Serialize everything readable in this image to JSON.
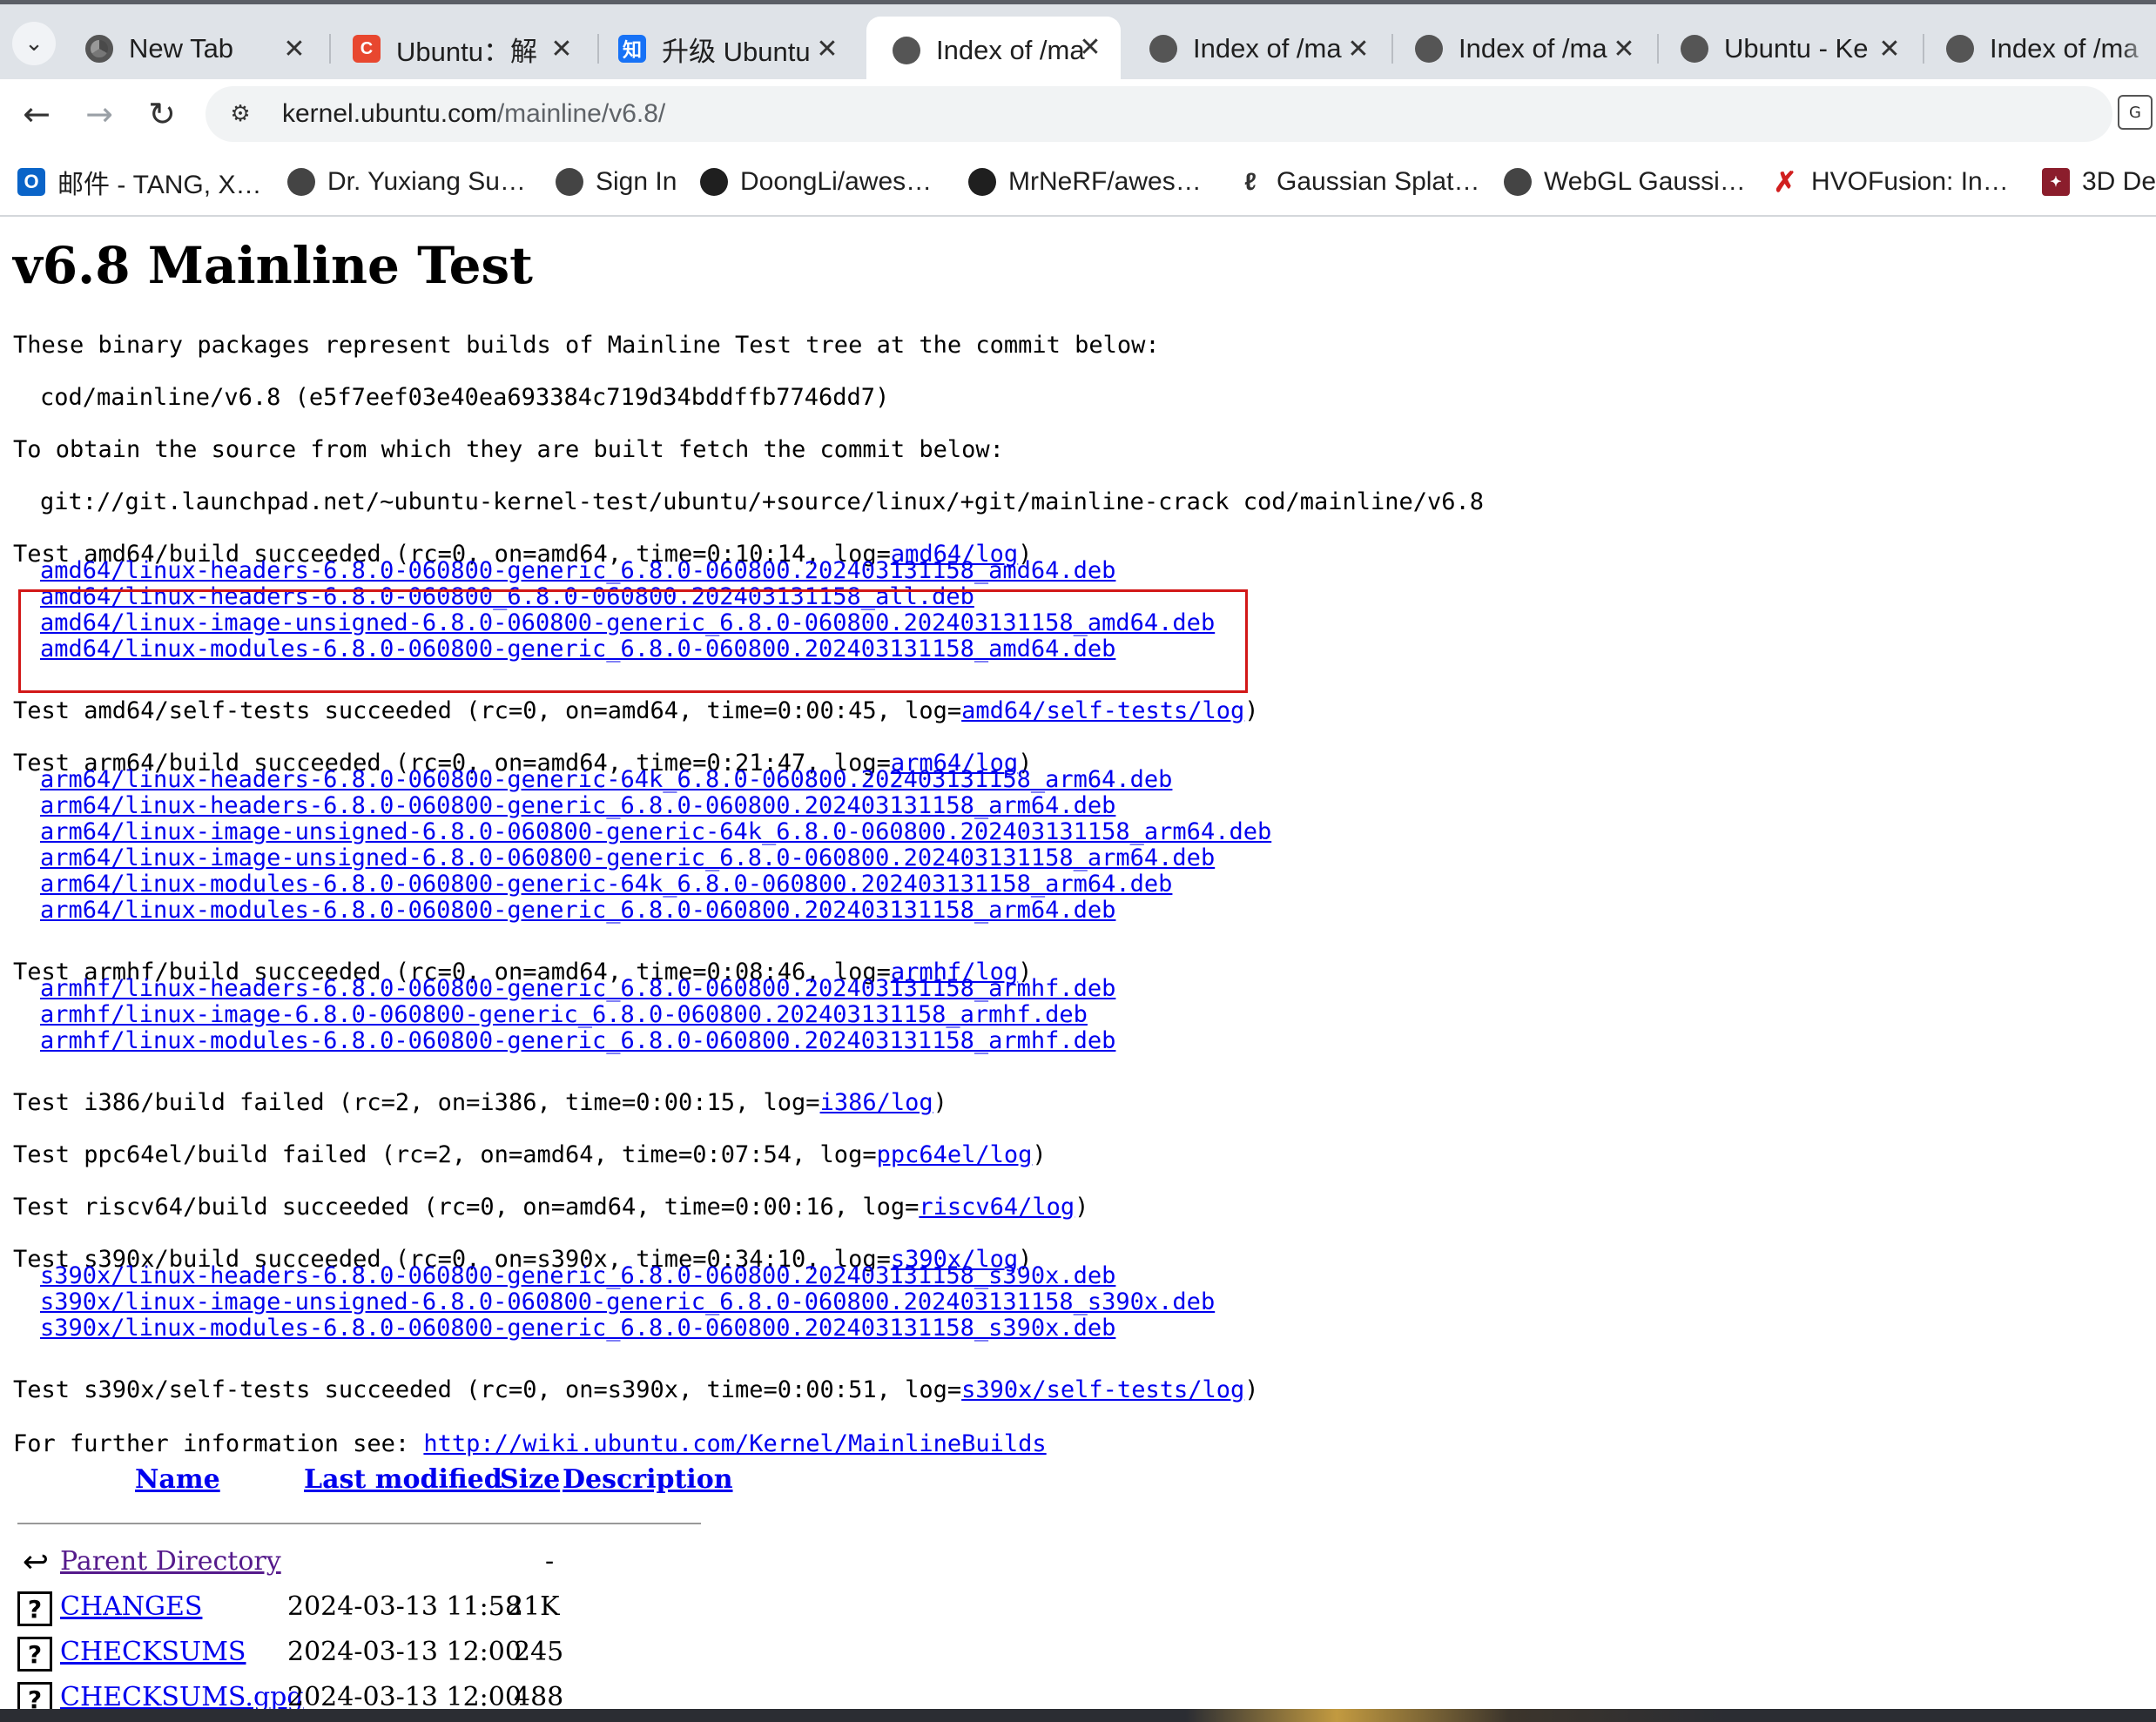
{
  "tabs": [
    {
      "title": "New Tab",
      "favicon": "chrome-icon",
      "active": false
    },
    {
      "title": "Ubuntu：解",
      "favicon": "c-icon",
      "active": false
    },
    {
      "title": "升级 Ubuntu",
      "favicon": "zhihu-icon",
      "active": false
    },
    {
      "title": "Index of /ma",
      "favicon": "globe-icon",
      "active": true
    },
    {
      "title": "Index of /ma",
      "favicon": "globe-icon",
      "active": false
    },
    {
      "title": "Index of /ma",
      "favicon": "globe-icon",
      "active": false
    },
    {
      "title": "Ubuntu - Ke",
      "favicon": "globe-icon",
      "active": false
    },
    {
      "title": "Index of /ma",
      "favicon": "globe-icon",
      "active": false
    }
  ],
  "address": {
    "host": "kernel.ubuntu.com",
    "path": "/mainline/v6.8/"
  },
  "bookmarks": [
    {
      "label": "邮件 - TANG, X…"
    },
    {
      "label": "Dr. Yuxiang Su…"
    },
    {
      "label": "Sign In"
    },
    {
      "label": "DoongLi/awes…"
    },
    {
      "label": "MrNeRF/awes…"
    },
    {
      "label": "Gaussian Splat…"
    },
    {
      "label": "WebGL Gaussi…"
    },
    {
      "label": "HVOFusion: In…"
    },
    {
      "label": "3D Del"
    }
  ],
  "page": {
    "title": "v6.8 Mainline Test",
    "intro": "These binary packages represent builds of Mainline Test tree at the commit below:",
    "commit": "cod/mainline/v6.8 (e5f7eef03e40ea693384c719d34bddffb7746dd7)",
    "source_intro": "To obtain the source from which they are built fetch the commit below:",
    "source_cmd": "git://git.launchpad.net/~ubuntu-kernel-test/ubuntu/+source/linux/+git/mainline-crack cod/mainline/v6.8",
    "tests": [
      {
        "prefix": "Test amd64/build succeeded (rc=0, on=amd64, time=0:10:14, log=",
        "log": "amd64/log",
        "suffix": ")",
        "files": [
          "amd64/linux-headers-6.8.0-060800-generic_6.8.0-060800.202403131158_amd64.deb",
          "amd64/linux-headers-6.8.0-060800_6.8.0-060800.202403131158_all.deb",
          "amd64/linux-image-unsigned-6.8.0-060800-generic_6.8.0-060800.202403131158_amd64.deb",
          "amd64/linux-modules-6.8.0-060800-generic_6.8.0-060800.202403131158_amd64.deb"
        ]
      },
      {
        "prefix": "Test amd64/self-tests succeeded (rc=0, on=amd64, time=0:00:45, log=",
        "log": "amd64/self-tests/log",
        "suffix": ")",
        "files": []
      },
      {
        "prefix": "Test arm64/build succeeded (rc=0, on=amd64, time=0:21:47, log=",
        "log": "arm64/log",
        "suffix": ")",
        "files": [
          "arm64/linux-headers-6.8.0-060800-generic-64k_6.8.0-060800.202403131158_arm64.deb",
          "arm64/linux-headers-6.8.0-060800-generic_6.8.0-060800.202403131158_arm64.deb",
          "arm64/linux-image-unsigned-6.8.0-060800-generic-64k_6.8.0-060800.202403131158_arm64.deb",
          "arm64/linux-image-unsigned-6.8.0-060800-generic_6.8.0-060800.202403131158_arm64.deb",
          "arm64/linux-modules-6.8.0-060800-generic-64k_6.8.0-060800.202403131158_arm64.deb",
          "arm64/linux-modules-6.8.0-060800-generic_6.8.0-060800.202403131158_arm64.deb"
        ]
      },
      {
        "prefix": "Test armhf/build succeeded (rc=0, on=amd64, time=0:08:46, log=",
        "log": "armhf/log",
        "suffix": ")",
        "files": [
          "armhf/linux-headers-6.8.0-060800-generic_6.8.0-060800.202403131158_armhf.deb",
          "armhf/linux-image-6.8.0-060800-generic_6.8.0-060800.202403131158_armhf.deb",
          "armhf/linux-modules-6.8.0-060800-generic_6.8.0-060800.202403131158_armhf.deb"
        ]
      },
      {
        "prefix": "Test i386/build failed (rc=2, on=i386, time=0:00:15, log=",
        "log": "i386/log",
        "suffix": ")",
        "files": []
      },
      {
        "prefix": "Test ppc64el/build failed (rc=2, on=amd64, time=0:07:54, log=",
        "log": "ppc64el/log",
        "suffix": ")",
        "files": []
      },
      {
        "prefix": "Test riscv64/build succeeded (rc=0, on=amd64, time=0:00:16, log=",
        "log": "riscv64/log",
        "suffix": ")",
        "files": []
      },
      {
        "prefix": "Test s390x/build succeeded (rc=0, on=s390x, time=0:34:10, log=",
        "log": "s390x/log",
        "suffix": ")",
        "files": [
          "s390x/linux-headers-6.8.0-060800-generic_6.8.0-060800.202403131158_s390x.deb",
          "s390x/linux-image-unsigned-6.8.0-060800-generic_6.8.0-060800.202403131158_s390x.deb",
          "s390x/linux-modules-6.8.0-060800-generic_6.8.0-060800.202403131158_s390x.deb"
        ]
      },
      {
        "prefix": "Test s390x/self-tests succeeded (rc=0, on=s390x, time=0:00:51, log=",
        "log": "s390x/self-tests/log",
        "suffix": ")",
        "files": []
      }
    ],
    "further_info": "For further information see: ",
    "further_link": "http://wiki.ubuntu.com/Kernel/MainlineBuilds",
    "listing_headers": {
      "name": "Name",
      "modified": "Last modified",
      "size": "Size",
      "description": "Description"
    },
    "listing": [
      {
        "name": "Parent Directory",
        "modified": "",
        "size": "-",
        "icon": "back-icon"
      },
      {
        "name": "CHANGES",
        "modified": "2024-03-13 11:58",
        "size": "21K",
        "icon": "unknown-file-icon"
      },
      {
        "name": "CHECKSUMS",
        "modified": "2024-03-13 12:00",
        "size": "245",
        "icon": "unknown-file-icon"
      },
      {
        "name": "CHECKSUMS.gpg",
        "modified": "2024-03-13 12:00",
        "size": "488",
        "icon": "unknown-file-icon"
      }
    ]
  },
  "colors": {
    "link": "#0000ee",
    "visited": "#551a8b",
    "highlight_box": "#d21818"
  }
}
